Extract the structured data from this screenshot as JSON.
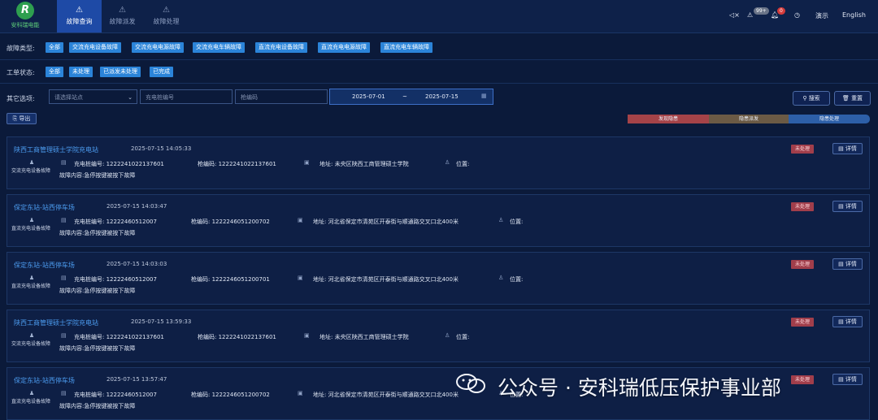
{
  "logo": {
    "mark": "R",
    "text": "安科瑞电能"
  },
  "tabs": [
    {
      "label": "故障查询",
      "icon": "fault-query-icon"
    },
    {
      "label": "故障派发",
      "icon": "dispatch-icon"
    },
    {
      "label": "故障处理",
      "icon": "handle-icon"
    }
  ],
  "header_right": {
    "mute_icon": "speaker-mute-icon",
    "warning_badge": "99+",
    "bell_badge": "0",
    "demo_label": "演示",
    "language": "English"
  },
  "filters": {
    "fault_type_label": "故障类型:",
    "fault_types": [
      "全部",
      "交流充电设备故障",
      "交流充电电源故障",
      "交流充电车辆故障",
      "直流充电设备故障",
      "直流充电电源故障",
      "直流充电车辆故障"
    ],
    "work_status_label": "工单状态:",
    "work_status": [
      "全部",
      "未处理",
      "已派发未处理",
      "已完成"
    ],
    "other_label": "其它选项:",
    "station_placeholder": "请选择站点",
    "pile_placeholder": "充电桩编号",
    "gun_placeholder": "枪编码",
    "date_start": "2025-07-01",
    "date_sep": "~",
    "date_end": "2025-07-15",
    "search_label": "搜索",
    "reset_label": "重置",
    "export_label": "导出"
  },
  "progress_steps": [
    "发现隐患",
    "隐患派发",
    "隐患处理"
  ],
  "colors": {
    "background": "#0b1a3a",
    "chip": "#2b84d9",
    "status_unhandled": "#a13e4b",
    "step_found": "#a54348",
    "step_dispatch": "#6b5a45",
    "step_handle": "#2d5fa8",
    "link": "#4c9cf0"
  },
  "labels": {
    "pile_no": "充电桩编号:",
    "gun_code": "枪编码:",
    "address": "地址:",
    "location": "位置:",
    "detail": "详情"
  },
  "records": [
    {
      "station": "陕西工商管理硕士学院充电站",
      "time": "2025-07-15 14:05:33",
      "type": "交流充电设备故障",
      "pile_no": "1222241022137601",
      "gun_code": "1222241022137601",
      "address": "未央区陕西工商管理硕士学院",
      "location": "",
      "content": "故障内容:急停按键被按下故障",
      "status": "未处理"
    },
    {
      "station": "保定东站-站西停车场",
      "time": "2025-07-15 14:03:47",
      "type": "直流充电设备故障",
      "pile_no": "12222460512007",
      "gun_code": "1222246051200702",
      "address": "河北省保定市清苑区开泰街与顺通路交叉口北400米",
      "location": "",
      "content": "故障内容:急停按键被按下故障",
      "status": "未处理"
    },
    {
      "station": "保定东站-站西停车场",
      "time": "2025-07-15 14:03:03",
      "type": "直流充电设备故障",
      "pile_no": "12222460512007",
      "gun_code": "1222246051200701",
      "address": "河北省保定市清苑区开泰街与顺通路交叉口北400米",
      "location": "",
      "content": "故障内容:急停按键被按下故障",
      "status": "未处理"
    },
    {
      "station": "陕西工商管理硕士学院充电站",
      "time": "2025-07-15 13:59:33",
      "type": "交流充电设备故障",
      "pile_no": "1222241022137601",
      "gun_code": "1222241022137601",
      "address": "未央区陕西工商管理硕士学院",
      "location": "",
      "content": "故障内容:急停按键被按下故障",
      "status": "未处理"
    },
    {
      "station": "保定东站-站西停车场",
      "time": "2025-07-15 13:57:47",
      "type": "直流充电设备故障",
      "pile_no": "12222460512007",
      "gun_code": "1222246051200702",
      "address": "河北省保定市清苑区开泰街与顺通路交叉口北400米",
      "location": "",
      "content": "故障内容:急停按键被按下故障",
      "status": "未处理"
    }
  ],
  "watermark": {
    "text": "公众号 · 安科瑞低压保护事业部"
  }
}
